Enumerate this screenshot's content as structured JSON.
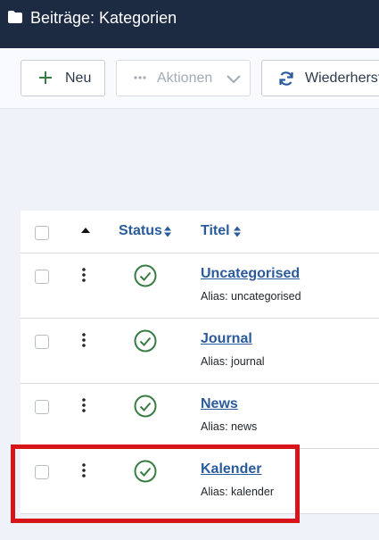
{
  "header": {
    "title": "Beiträge: Kategorien",
    "icon": "folder-icon"
  },
  "toolbar": {
    "new_label": "Neu",
    "actions_label": "Aktionen",
    "restore_label": "Wiederherst"
  },
  "table": {
    "columns": {
      "status": "Status",
      "title": "Titel"
    },
    "rows": [
      {
        "title": "Uncategorised",
        "alias": "Alias: uncategorised",
        "status": "published"
      },
      {
        "title": "Journal",
        "alias": "Alias: journal",
        "status": "published"
      },
      {
        "title": "News",
        "alias": "Alias: news",
        "status": "published"
      },
      {
        "title": "Kalender",
        "alias": "Alias: kalender",
        "status": "published"
      }
    ]
  },
  "colors": {
    "header_bg": "#1c2a42",
    "link": "#2a5b9c",
    "published": "#3a7d44",
    "highlight": "#d7141a"
  }
}
